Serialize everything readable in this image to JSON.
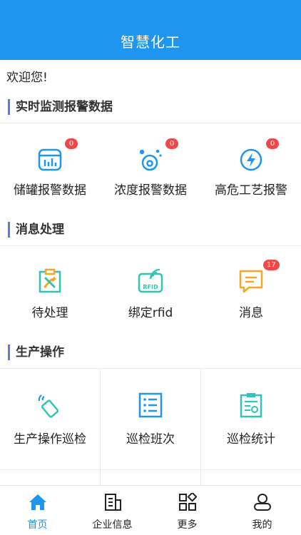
{
  "header": {
    "title": "智慧化工"
  },
  "welcome": "欢迎您!",
  "sections": {
    "realtime": {
      "title": "实时监测报警数据",
      "items": [
        {
          "label": "储罐报警数据",
          "badge": "0",
          "icon": "tank-icon"
        },
        {
          "label": "浓度报警数据",
          "badge": "0",
          "icon": "concentration-icon"
        },
        {
          "label": "高危工艺报警",
          "badge": "0",
          "icon": "lightning-icon"
        }
      ]
    },
    "messages": {
      "title": "消息处理",
      "items": [
        {
          "label": "待处理",
          "icon": "pending-clipboard-icon"
        },
        {
          "label": "绑定rfid",
          "icon": "rfid-icon"
        },
        {
          "label": "消息",
          "badge": "17",
          "icon": "message-icon"
        }
      ]
    },
    "production": {
      "title": "生产操作",
      "items": [
        {
          "label": "生产操作巡检",
          "icon": "scanner-icon"
        },
        {
          "label": "巡检班次",
          "icon": "list-icon"
        },
        {
          "label": "巡检统计",
          "icon": "statistics-clipboard-icon"
        }
      ]
    }
  },
  "tabbar": {
    "items": [
      {
        "label": "首页",
        "icon": "home-icon",
        "active": true
      },
      {
        "label": "企业信息",
        "icon": "building-icon"
      },
      {
        "label": "更多",
        "icon": "grid-icon"
      },
      {
        "label": "我的",
        "icon": "user-icon"
      }
    ]
  },
  "colors": {
    "primary": "#1e96f0",
    "badge": "#f04848",
    "section_bar": "#5b7cd6",
    "teal": "#2ec4b6",
    "orange": "#f5a623"
  }
}
